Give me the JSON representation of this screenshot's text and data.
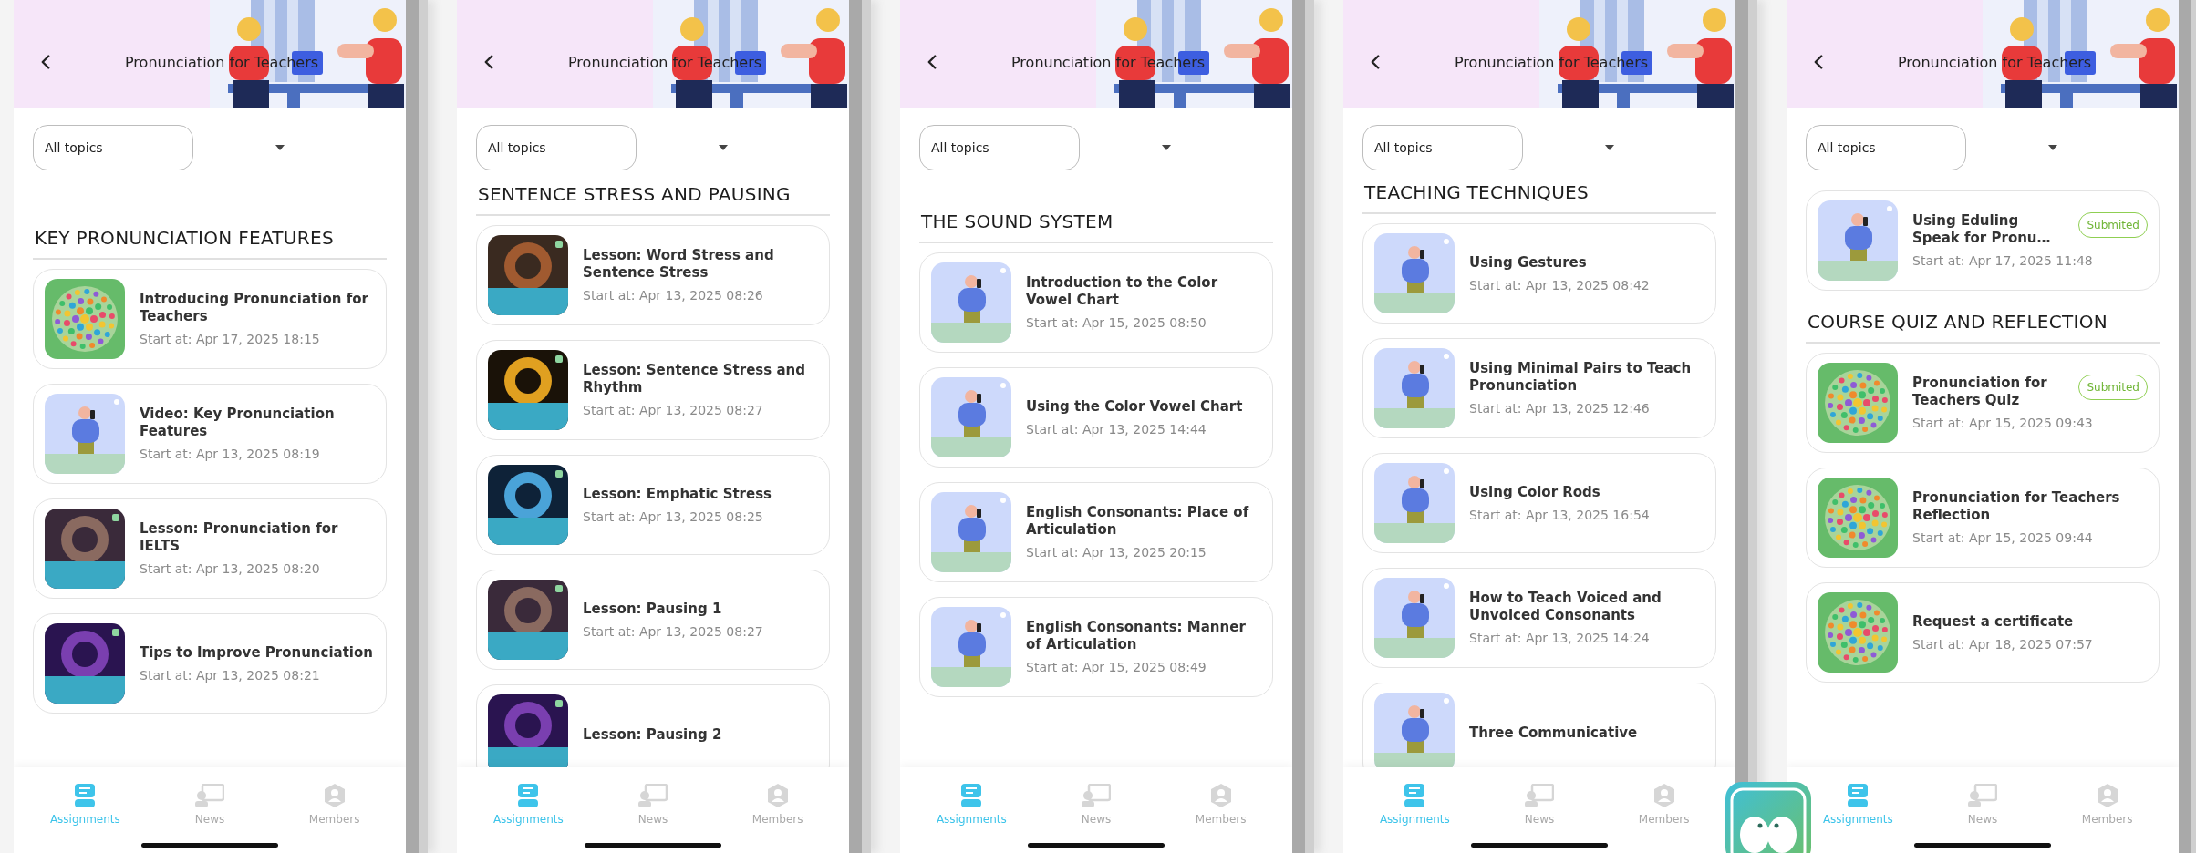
{
  "screens": [
    {
      "header": {
        "title": "Pronunciation for Teachers"
      },
      "filter": {
        "value": "All topics"
      },
      "sections": [
        {
          "title": "KEY PRONUNCIATION FEATURES",
          "items": [
            {
              "title": "Introducing Pronunciation for Teachers",
              "date": "Start at: Apr 17, 2025 18:15",
              "kind": "mandala"
            },
            {
              "title": "Video: Key Pronunciation Features",
              "date": "Start at: Apr 13, 2025 08:19",
              "kind": "figure"
            },
            {
              "title": "Lesson: Pronunciation for IELTS",
              "date": "Start at: Apr 13, 2025 08:20"
            },
            {
              "title": "Tips to Improve Pronunciation",
              "date": "Start at: Apr 13, 2025 08:21"
            }
          ]
        }
      ],
      "nav": [
        {
          "label": "Assignments",
          "selected": true
        },
        {
          "label": "News",
          "selected": false
        },
        {
          "label": "Members",
          "selected": false
        }
      ]
    },
    {
      "header": {
        "title": "Pronunciation for Teachers"
      },
      "filter": {
        "value": "All topics"
      },
      "sections": [
        {
          "title": "SENTENCE STRESS AND PAUSING",
          "items": [
            {
              "title": "Lesson: Word Stress and Sentence Stress",
              "date": "Start at: Apr 13, 2025 08:26"
            },
            {
              "title": "Lesson: Sentence Stress and Rhythm",
              "date": "Start at: Apr 13, 2025 08:27"
            },
            {
              "title": "Lesson: Emphatic Stress",
              "date": "Start at: Apr 13, 2025 08:25"
            },
            {
              "title": "Lesson: Pausing 1",
              "date": "Start at: Apr 13, 2025 08:27"
            },
            {
              "title": "Lesson: Pausing 2"
            }
          ]
        }
      ],
      "nav": [
        {
          "label": "Assignments",
          "selected": true
        },
        {
          "label": "News",
          "selected": false
        },
        {
          "label": "Members",
          "selected": false
        }
      ]
    },
    {
      "header": {
        "title": "Pronunciation for Teachers"
      },
      "filter": {
        "value": "All topics"
      },
      "sections": [
        {
          "title": "THE SOUND SYSTEM",
          "items": [
            {
              "title": "Introduction to the Color Vowel Chart",
              "date": "Start at: Apr 15, 2025 08:50",
              "kind": "figure"
            },
            {
              "title": "Using the Color Vowel Chart",
              "date": "Start at: Apr 13, 2025 14:44",
              "kind": "figure"
            },
            {
              "title": "English Consonants: Place of Articulation",
              "date": "Start at: Apr 13, 2025 20:15",
              "kind": "figure"
            },
            {
              "title": "English Consonants: Manner of Articulation",
              "date": "Start at: Apr 15, 2025 08:49",
              "kind": "figure"
            }
          ]
        }
      ],
      "nav": [
        {
          "label": "Assignments",
          "selected": true
        },
        {
          "label": "News",
          "selected": false
        },
        {
          "label": "Members",
          "selected": false
        }
      ]
    },
    {
      "header": {
        "title": "Pronunciation for Teachers"
      },
      "filter": {
        "value": "All topics"
      },
      "sections": [
        {
          "title": "TEACHING TECHNIQUES",
          "items": [
            {
              "title": "Using Gestures",
              "date": "Start at: Apr 13, 2025 08:42",
              "kind": "figure"
            },
            {
              "title": "Using Minimal Pairs to Teach Pronunciation",
              "date": "Start at: Apr 13, 2025 12:46",
              "kind": "figure"
            },
            {
              "title": "Using Color Rods",
              "date": "Start at: Apr 13, 2025 16:54",
              "kind": "figure"
            },
            {
              "title": "How to Teach Voiced and Unvoiced Consonants",
              "date": "Start at: Apr 13, 2025 14:24",
              "kind": "figure"
            },
            {
              "title": "Three Communicative",
              "kind": "figure"
            }
          ]
        }
      ],
      "nav": [
        {
          "label": "Assignments",
          "selected": true
        },
        {
          "label": "News",
          "selected": false
        },
        {
          "label": "Members",
          "selected": false
        }
      ]
    },
    {
      "header": {
        "title": "Pronunciation for Teachers"
      },
      "filter": {
        "value": "All topics"
      },
      "sections": [
        {
          "items": [
            {
              "title": "Using Eduling Speak for Pronu…",
              "date": "Start at: Apr 17, 2025 11:48",
              "kind": "figure",
              "status": "Submited"
            }
          ]
        },
        {
          "title": "COURSE QUIZ AND REFLECTION",
          "items": [
            {
              "title": "Pronunciation for Teachers Quiz",
              "date": "Start at: Apr 15, 2025 09:43",
              "kind": "mandala",
              "status": "Submited"
            },
            {
              "title": "Pronunciation for Teachers Reflection",
              "date": "Start at: Apr 15, 2025 09:44",
              "kind": "mandala"
            },
            {
              "title": "Request a certificate",
              "date": "Start at: Apr 18, 2025 07:57",
              "kind": "mandala"
            }
          ]
        }
      ],
      "nav": [
        {
          "label": "Assignments",
          "selected": true
        },
        {
          "label": "News",
          "selected": false
        },
        {
          "label": "Members",
          "selected": false
        }
      ]
    }
  ]
}
